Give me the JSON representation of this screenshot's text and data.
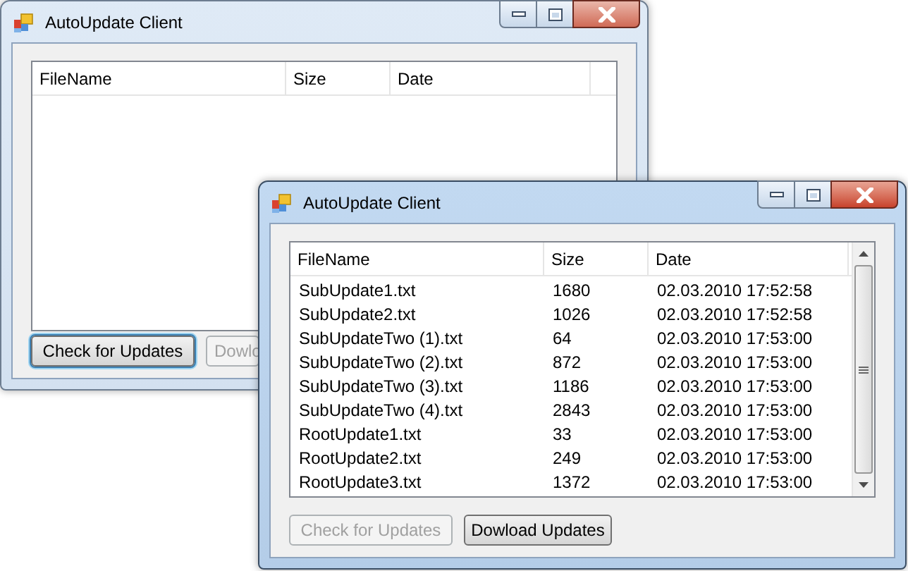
{
  "windows": [
    {
      "title": "AutoUpdate Client",
      "active": false,
      "scrollbar": false,
      "columns": [
        "FileName",
        "Size",
        "Date"
      ],
      "buttons": [
        {
          "label": "Check for Updates",
          "disabled": false,
          "focused": true
        },
        {
          "label": "Dowlo",
          "disabled": true,
          "focused": false
        }
      ]
    },
    {
      "title": "AutoUpdate Client",
      "active": true,
      "scrollbar": true,
      "columns": [
        "FileName",
        "Size",
        "Date"
      ],
      "rows": [
        [
          "SubUpdate1.txt",
          "1680",
          "02.03.2010 17:52:58"
        ],
        [
          "SubUpdate2.txt",
          "1026",
          "02.03.2010 17:52:58"
        ],
        [
          "SubUpdateTwo (1).txt",
          "64",
          "02.03.2010 17:53:00"
        ],
        [
          "SubUpdateTwo (2).txt",
          "872",
          "02.03.2010 17:53:00"
        ],
        [
          "SubUpdateTwo (3).txt",
          "1186",
          "02.03.2010 17:53:00"
        ],
        [
          "SubUpdateTwo (4).txt",
          "2843",
          "02.03.2010 17:53:00"
        ],
        [
          "RootUpdate1.txt",
          "33",
          "02.03.2010 17:53:00"
        ],
        [
          "RootUpdate2.txt",
          "249",
          "02.03.2010 17:53:00"
        ],
        [
          "RootUpdate3.txt",
          "1372",
          "02.03.2010 17:53:00"
        ]
      ],
      "buttons": [
        {
          "label": "Check for Updates",
          "disabled": true,
          "focused": false
        },
        {
          "label": "Dowload Updates",
          "disabled": false,
          "focused": false
        }
      ]
    }
  ]
}
